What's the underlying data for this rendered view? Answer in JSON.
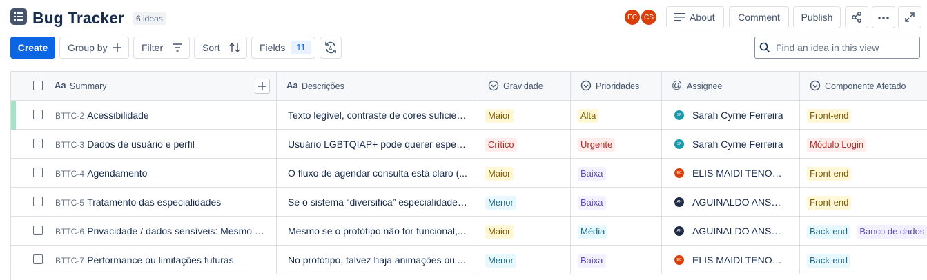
{
  "header": {
    "title": "Bug Tracker",
    "count": "6 ideas",
    "avatars": [
      {
        "initials": "EC",
        "color": "#d93f0b"
      },
      {
        "initials": "CS",
        "color": "#d93f0b"
      }
    ],
    "about_label": "About",
    "comment_label": "Comment",
    "publish_label": "Publish"
  },
  "toolbar": {
    "create_label": "Create",
    "group_by_label": "Group by",
    "filter_label": "Filter",
    "sort_label": "Sort",
    "fields_label": "Fields",
    "fields_count": "11",
    "search_placeholder": "Find an idea in this view"
  },
  "columns": {
    "summary": "Summary",
    "descricoes": "Descrições",
    "gravidade": "Gravidade",
    "prioridades": "Prioridades",
    "assignee": "Assignee",
    "componente": "Componente Afetado",
    "text_field_glyph": "Aa"
  },
  "colors": {
    "accent": "#0c66e4",
    "row_marker": "#a1e5c6"
  },
  "rows": [
    {
      "key": "BTTC-2",
      "summary": "Acessibilidade",
      "description": "Texto legível, contraste de cores suficien...",
      "gravidade": "Maior",
      "gravidade_color": "amber",
      "prioridade": "Alta",
      "prioridade_color": "amber",
      "assignee": "Sarah Cyrne Ferreira",
      "assignee_initials": "SF",
      "assignee_color": "#1d9aaa",
      "componentes": [
        {
          "label": "Front-end",
          "color": "amber"
        }
      ]
    },
    {
      "key": "BTTC-3",
      "summary": "Dados de usuário e perfil",
      "description": "Usuário LGBTQIAP+ pode querer especif...",
      "gravidade": "Crítico",
      "gravidade_color": "red",
      "prioridade": "Urgente",
      "prioridade_color": "red",
      "assignee": "Sarah Cyrne Ferreira",
      "assignee_initials": "SF",
      "assignee_color": "#1d9aaa",
      "componentes": [
        {
          "label": "Módulo Login",
          "color": "red"
        }
      ]
    },
    {
      "key": "BTTC-4",
      "summary": "Agendamento",
      "description": "O fluxo de agendar consulta está claro (...",
      "gravidade": "Maior",
      "gravidade_color": "amber",
      "prioridade": "Baixa",
      "prioridade_color": "purple",
      "assignee": "ELIS MAIDI TENORI...",
      "assignee_initials": "EC",
      "assignee_color": "#d93f0b",
      "componentes": [
        {
          "label": "Front-end",
          "color": "amber"
        }
      ]
    },
    {
      "key": "BTTC-5",
      "summary": "Tratamento das especialidades",
      "description": "Se o sistema “diversifica” especialidades ...",
      "gravidade": "Menor",
      "gravidade_color": "teal",
      "prioridade": "Baixa",
      "prioridade_color": "purple",
      "assignee": "AGUINALDO ANSEL...",
      "assignee_initials": "AN",
      "assignee_color": "#1f2a44",
      "componentes": [
        {
          "label": "Front-end",
          "color": "amber"
        }
      ]
    },
    {
      "key": "BTTC-6",
      "summary": "Privacidade / dados sensíveis: Mesmo se...",
      "description": "Mesmo se o protótipo não for funcional,...",
      "gravidade": "Maior",
      "gravidade_color": "amber",
      "prioridade": "Média",
      "prioridade_color": "teal",
      "assignee": "AGUINALDO ANSEL...",
      "assignee_initials": "AN",
      "assignee_color": "#1f2a44",
      "componentes": [
        {
          "label": "Back-end",
          "color": "teal"
        },
        {
          "label": "Banco de dados",
          "color": "purple"
        }
      ]
    },
    {
      "key": "BTTC-7",
      "summary": "Performance ou limitações futuras",
      "description": "No protótipo, talvez haja animações ou ...",
      "gravidade": "Menor",
      "gravidade_color": "teal",
      "prioridade": "Baixa",
      "prioridade_color": "purple",
      "assignee": "ELIS MAIDI TENORI...",
      "assignee_initials": "EC",
      "assignee_color": "#d93f0b",
      "componentes": [
        {
          "label": "Back-end",
          "color": "teal"
        }
      ]
    }
  ]
}
